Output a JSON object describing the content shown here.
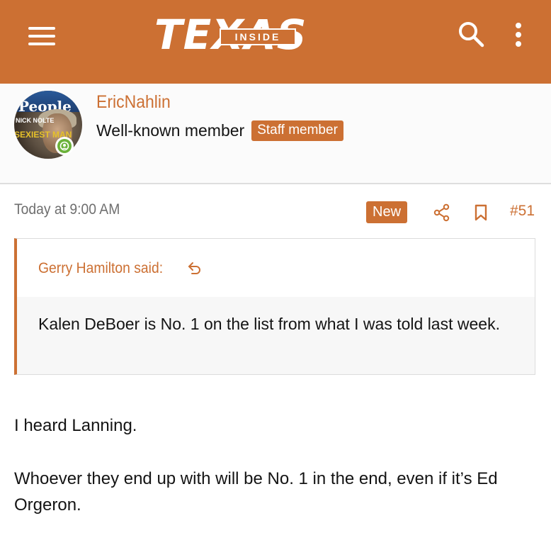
{
  "header": {
    "logo_main": "TEXAS",
    "logo_inside": "INSIDE",
    "menu_icon": "hamburger-menu-icon",
    "search_icon": "search-icon",
    "more_icon": "vertical-dots-icon",
    "brand_color": "#cc7033"
  },
  "member": {
    "username": "EricNahlin",
    "role": "Well-known member",
    "staff_badge": "Staff member",
    "avatar_text": {
      "people": "People",
      "nick": "NICK NOLTE",
      "sexiest": "SEXIEST MAN"
    },
    "online_icon": "online-status-icon"
  },
  "post": {
    "time": "Today at 9:00 AM",
    "new_badge": "New",
    "share_icon": "share-icon",
    "bookmark_icon": "bookmark-icon",
    "number": "#51",
    "quote": {
      "author": "Gerry Hamilton said:",
      "jump_icon": "jump-to-quote-icon",
      "text": "Kalen DeBoer is No. 1 on the list from what I was told last week."
    },
    "message": [
      "I heard Lanning.",
      "Whoever they end up with will be No. 1 in the end, even if it’s Ed Orgeron."
    ]
  }
}
